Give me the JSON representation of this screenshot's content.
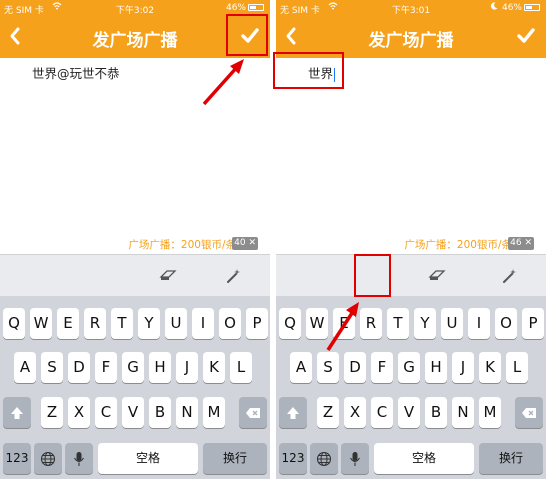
{
  "status_bar": {
    "carrier": "无 SIM 卡"
  },
  "screens": [
    {
      "time": "下午3:02",
      "battery": "46%",
      "title": "发广场广播",
      "input_text": "世界@玩世不恭",
      "cost_label": "广场广播：200银币/条",
      "remaining_count": "40"
    },
    {
      "time": "下午3:01",
      "battery": "46%",
      "title": "发广场广播",
      "input_text": "世界",
      "cost_label": "广场广播：200银币/条",
      "remaining_count": "46"
    }
  ],
  "keyboard": {
    "row1": [
      "Q",
      "W",
      "E",
      "R",
      "T",
      "Y",
      "U",
      "I",
      "O",
      "P"
    ],
    "row2": [
      "A",
      "S",
      "D",
      "F",
      "G",
      "H",
      "J",
      "K",
      "L"
    ],
    "row3": [
      "Z",
      "X",
      "C",
      "V",
      "B",
      "N",
      "M"
    ],
    "numbers_label": "123",
    "space_label": "空格",
    "return_label": "换行"
  },
  "colors": {
    "header": "#f6a11b",
    "accent_text": "#f6a11b",
    "annotation": "#e00000",
    "keyboard_bg": "#d1d5db"
  },
  "icons": [
    "back-chevron-icon",
    "checkmark-icon",
    "eraser-icon",
    "magic-wand-icon",
    "shift-icon",
    "delete-icon",
    "globe-icon",
    "microphone-icon",
    "wifi-icon"
  ]
}
